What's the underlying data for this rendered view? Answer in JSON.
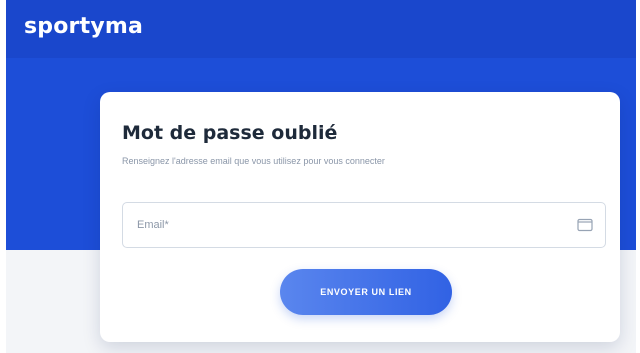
{
  "header": {
    "brand": "sportyma",
    "bg_color": "#1d4ed8"
  },
  "card": {
    "title": "Mot de passe oublié",
    "subtitle": "Renseignez l'adresse email que vous utilisez pour vous connecter",
    "email_field": {
      "placeholder": "Email*",
      "icon": "mail-icon"
    },
    "submit_label": "ENVOYER UN LIEN",
    "accent_color": "#3162e4"
  }
}
